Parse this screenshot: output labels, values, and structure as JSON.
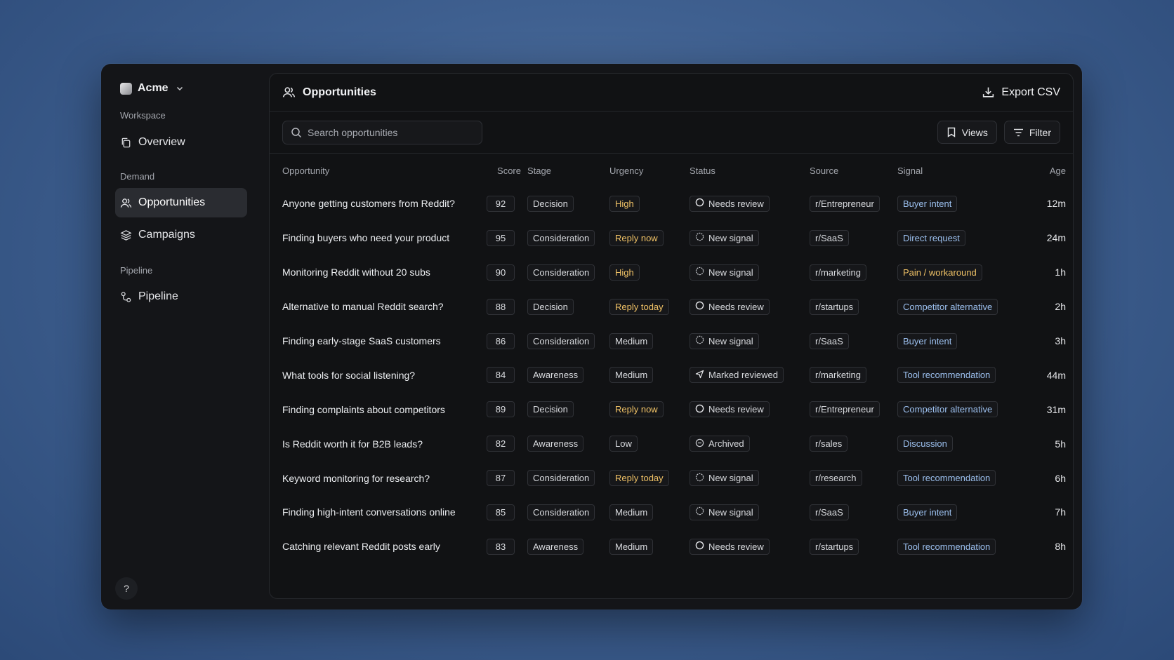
{
  "workspace": {
    "name": "Acme"
  },
  "sidebar": {
    "groups": [
      "Workspace",
      "Demand",
      "Pipeline"
    ],
    "items": [
      {
        "label": "Overview",
        "icon": "copy-icon"
      },
      {
        "label": "Opportunities",
        "icon": "users-icon",
        "active": true
      },
      {
        "label": "Campaigns",
        "icon": "layers-icon"
      },
      {
        "label": "Pipeline",
        "icon": "pipeline-icon"
      }
    ],
    "help_label": "?"
  },
  "header": {
    "title": "Opportunities",
    "export_label": "Export CSV"
  },
  "toolbar": {
    "search_placeholder": "Search opportunities",
    "views_label": "Views",
    "filter_label": "Filter"
  },
  "table": {
    "columns": [
      "Opportunity",
      "Score",
      "Stage",
      "Urgency",
      "Status",
      "Source",
      "Signal",
      "Age"
    ],
    "rows": [
      {
        "opportunity": "Anyone getting customers from Reddit?",
        "score": "92",
        "stage": "Decision",
        "urgency": "High",
        "status": "Needs review",
        "source": "r/Entrepreneur",
        "signal": "Buyer intent",
        "age": "12m"
      },
      {
        "opportunity": "Finding buyers who need your product",
        "score": "95",
        "stage": "Consideration",
        "urgency": "Reply now",
        "status": "New signal",
        "source": "r/SaaS",
        "signal": "Direct request",
        "age": "24m"
      },
      {
        "opportunity": "Monitoring Reddit without 20 subs",
        "score": "90",
        "stage": "Consideration",
        "urgency": "High",
        "status": "New signal",
        "source": "r/marketing",
        "signal": "Pain / workaround",
        "age": "1h"
      },
      {
        "opportunity": "Alternative to manual Reddit search?",
        "score": "88",
        "stage": "Decision",
        "urgency": "Reply today",
        "status": "Needs review",
        "source": "r/startups",
        "signal": "Competitor alternative",
        "age": "2h"
      },
      {
        "opportunity": "Finding early-stage SaaS customers",
        "score": "86",
        "stage": "Consideration",
        "urgency": "Medium",
        "status": "New signal",
        "source": "r/SaaS",
        "signal": "Buyer intent",
        "age": "3h"
      },
      {
        "opportunity": "What tools for social listening?",
        "score": "84",
        "stage": "Awareness",
        "urgency": "Medium",
        "status": "Marked reviewed",
        "source": "r/marketing",
        "signal": "Tool recommendation",
        "age": "44m"
      },
      {
        "opportunity": "Finding complaints about competitors",
        "score": "89",
        "stage": "Decision",
        "urgency": "Reply now",
        "status": "Needs review",
        "source": "r/Entrepreneur",
        "signal": "Competitor alternative",
        "age": "31m"
      },
      {
        "opportunity": "Is Reddit worth it for B2B leads?",
        "score": "82",
        "stage": "Awareness",
        "urgency": "Low",
        "status": "Archived",
        "source": "r/sales",
        "signal": "Discussion",
        "age": "5h"
      },
      {
        "opportunity": "Keyword monitoring for research?",
        "score": "87",
        "stage": "Consideration",
        "urgency": "Reply today",
        "status": "New signal",
        "source": "r/research",
        "signal": "Tool recommendation",
        "age": "6h"
      },
      {
        "opportunity": "Finding high-intent conversations online",
        "score": "85",
        "stage": "Consideration",
        "urgency": "Medium",
        "status": "New signal",
        "source": "r/SaaS",
        "signal": "Buyer intent",
        "age": "7h"
      },
      {
        "opportunity": "Catching relevant Reddit posts early",
        "score": "83",
        "stage": "Awareness",
        "urgency": "Medium",
        "status": "Needs review",
        "source": "r/startups",
        "signal": "Tool recommendation",
        "age": "8h"
      }
    ]
  },
  "colors": {
    "accent_warn": "#f0c266",
    "signal_blue": "#9cc0ef",
    "signal_amber": "#f0c266"
  }
}
